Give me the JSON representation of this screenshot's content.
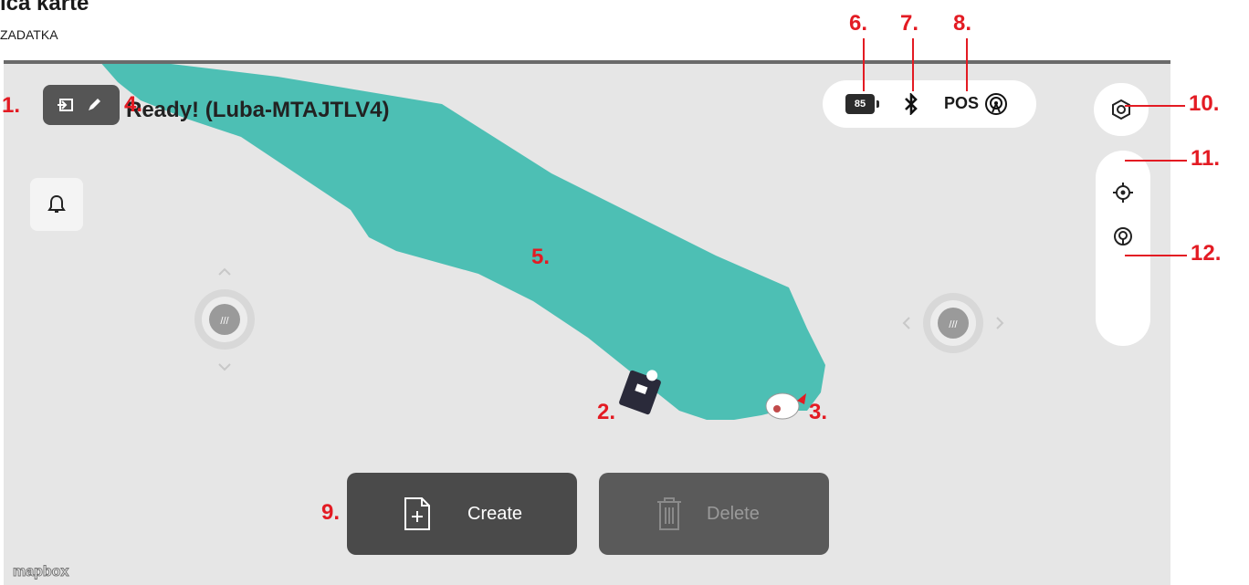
{
  "document": {
    "title": "ica karte",
    "subtitle": "ZADATKA"
  },
  "app": {
    "status_text": "Ready! (Luba-MTAJTLV4)",
    "battery_level": "85",
    "pos_label": "POS",
    "mapbox_label": "mapbox",
    "buttons": {
      "create_label": "Create",
      "delete_label": "Delete"
    },
    "icons": {
      "edit_pill": [
        "exit-icon",
        "pencil-icon"
      ],
      "bell": "bell-icon",
      "bluetooth": "bluetooth-icon",
      "pos_signal": "antenna-signal-icon",
      "settings": "hexagon-settings-icon",
      "locate": "crosshair-icon",
      "rtk": "location-pin-icon",
      "create": "add-file-icon",
      "delete": "trash-icon",
      "robot": "mower-icon",
      "base": "charging-station-icon"
    }
  },
  "annotations": {
    "m1": "1.",
    "m2": "2.",
    "m3": "3.",
    "m4": "4.",
    "m5": "5.",
    "m6": "6.",
    "m7": "7.",
    "m8": "8.",
    "m9": "9.",
    "m10": "10.",
    "m11": "11.",
    "m12": "12."
  },
  "colors": {
    "zone": "#4dbfb4",
    "map_bg": "#e6e6e6",
    "marker": "#e31b23",
    "button_dark": "#4a4a4a"
  }
}
